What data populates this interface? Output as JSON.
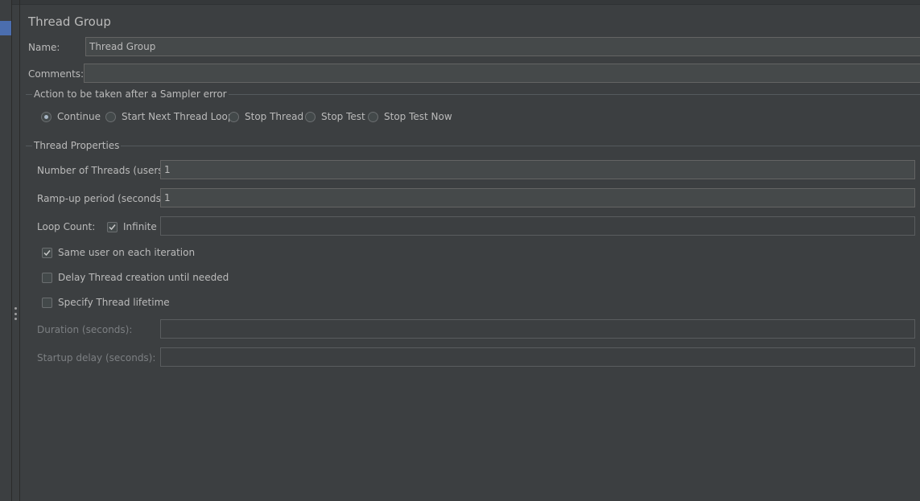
{
  "panel": {
    "title": "Thread Group",
    "name_label": "Name:",
    "name_value": "Thread Group",
    "comments_label": "Comments:",
    "comments_value": ""
  },
  "sampler_error": {
    "legend": "Action to be taken after a Sampler error",
    "options": [
      {
        "label": "Continue",
        "selected": true
      },
      {
        "label": "Start Next Thread Loop",
        "selected": false
      },
      {
        "label": "Stop Thread",
        "selected": false
      },
      {
        "label": "Stop Test",
        "selected": false
      },
      {
        "label": "Stop Test Now",
        "selected": false
      }
    ]
  },
  "thread_properties": {
    "legend": "Thread Properties",
    "threads_label": "Number of Threads (users):",
    "threads_value": "1",
    "rampup_label": "Ramp-up period (seconds):",
    "rampup_value": "1",
    "loop_label": "Loop Count:",
    "infinite_label": "Infinite",
    "infinite_checked": true,
    "loop_value": "",
    "same_user_label": "Same user on each iteration",
    "same_user_checked": true,
    "delay_label": "Delay Thread creation until needed",
    "delay_checked": false,
    "lifetime_label": "Specify Thread lifetime",
    "lifetime_checked": false,
    "duration_label": "Duration (seconds):",
    "duration_value": "",
    "startup_label": "Startup delay (seconds):",
    "startup_value": ""
  },
  "colors": {
    "background": "#3c3f41",
    "field": "#45494a",
    "accent": "#4b6eaf"
  }
}
